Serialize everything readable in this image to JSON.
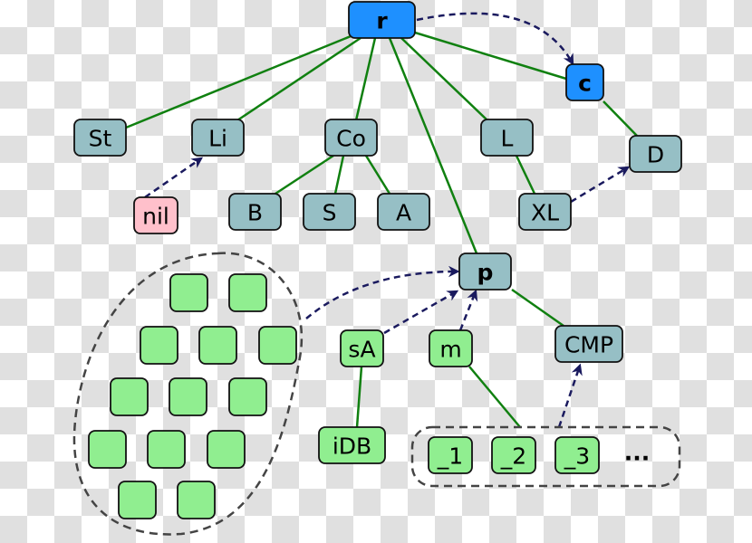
{
  "colors": {
    "highlight": "#1e90ff",
    "default": "#96bfc5",
    "nil": "#ffc0cb",
    "green": "#90ee90",
    "tree_edge": "#108010",
    "reference": "#1a1a5e"
  },
  "nodes": {
    "r": "r",
    "c": "c",
    "St": "St",
    "Li": "Li",
    "Co": "Co",
    "L": "L",
    "D": "D",
    "nil": "nil",
    "B": "B",
    "S": "S",
    "A": "A",
    "XL": "XL",
    "p": "p",
    "sA": "sA",
    "m": "m",
    "CMP": "CMP",
    "iDB": "iDB",
    "_1": "_1",
    "_2": "_2",
    "_3": "_3"
  },
  "ellipsis": "...",
  "unlabeled_green_nodes": 13
}
